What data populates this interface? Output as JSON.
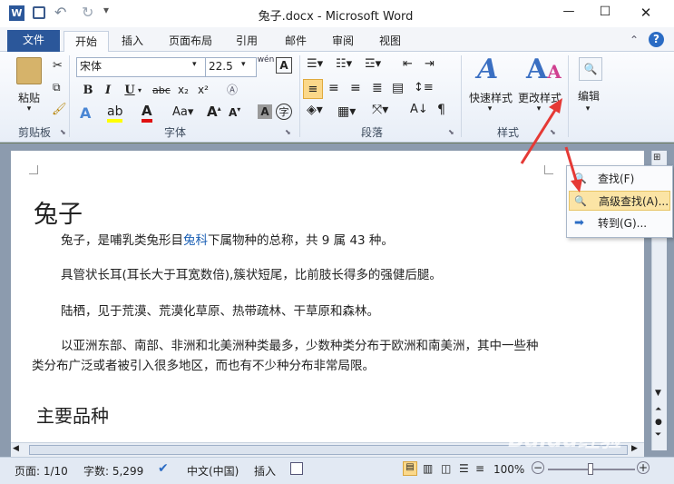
{
  "window": {
    "title": "兔子.docx - Microsoft Word",
    "minimize": "—",
    "maximize": "☐",
    "close": "✕"
  },
  "tabs": [
    {
      "label": "文件"
    },
    {
      "label": "开始"
    },
    {
      "label": "插入"
    },
    {
      "label": "页面布局"
    },
    {
      "label": "引用"
    },
    {
      "label": "邮件"
    },
    {
      "label": "审阅"
    },
    {
      "label": "视图"
    }
  ],
  "clipboard": {
    "paste": "粘贴",
    "label": "剪贴板"
  },
  "font": {
    "name": "宋体",
    "size": "22.5",
    "label": "字体",
    "pinyin": "wén"
  },
  "paragraph": {
    "label": "段落"
  },
  "styles": {
    "quick": "快速样式",
    "change": "更改样式",
    "label": "样式"
  },
  "editing": {
    "label": "编辑",
    "find_label": "查找"
  },
  "document": {
    "title": "兔子",
    "paragraphs": [
      {
        "before": "兔子，是哺乳类兔形目",
        "link": "兔科",
        "after": "下属物种的总称，共 9 属 43 种。"
      },
      {
        "text": "具管状长耳(耳长大于耳宽数倍),簇状短尾，比前肢长得多的强健后腿。"
      },
      {
        "text": "陆栖，见于荒漠、荒漠化草原、热带疏林、干草原和森林。"
      },
      {
        "text": "以亚洲东部、南部、非洲和北美洲种类最多，少数种类分布于欧洲和南美洲，其中一些种类分布广泛或者被引入很多地区，而也有不少种分布非常局限。"
      }
    ],
    "heading2": "主要品种"
  },
  "popup_menu": {
    "items": [
      {
        "label": "查找(F)"
      },
      {
        "label": "高级查找(A)..."
      },
      {
        "label": "转到(G)..."
      }
    ]
  },
  "statusbar": {
    "page": "页面: 1/10",
    "words": "字数: 5,299",
    "language": "中文(中国)",
    "mode": "插入",
    "zoom": "100%"
  },
  "watermark": "Baidu经验",
  "colors": {
    "file_tab": "#2b579a",
    "arrow": "#e53935",
    "highlight": "#fbe4a5",
    "link": "#1a5fb4"
  }
}
